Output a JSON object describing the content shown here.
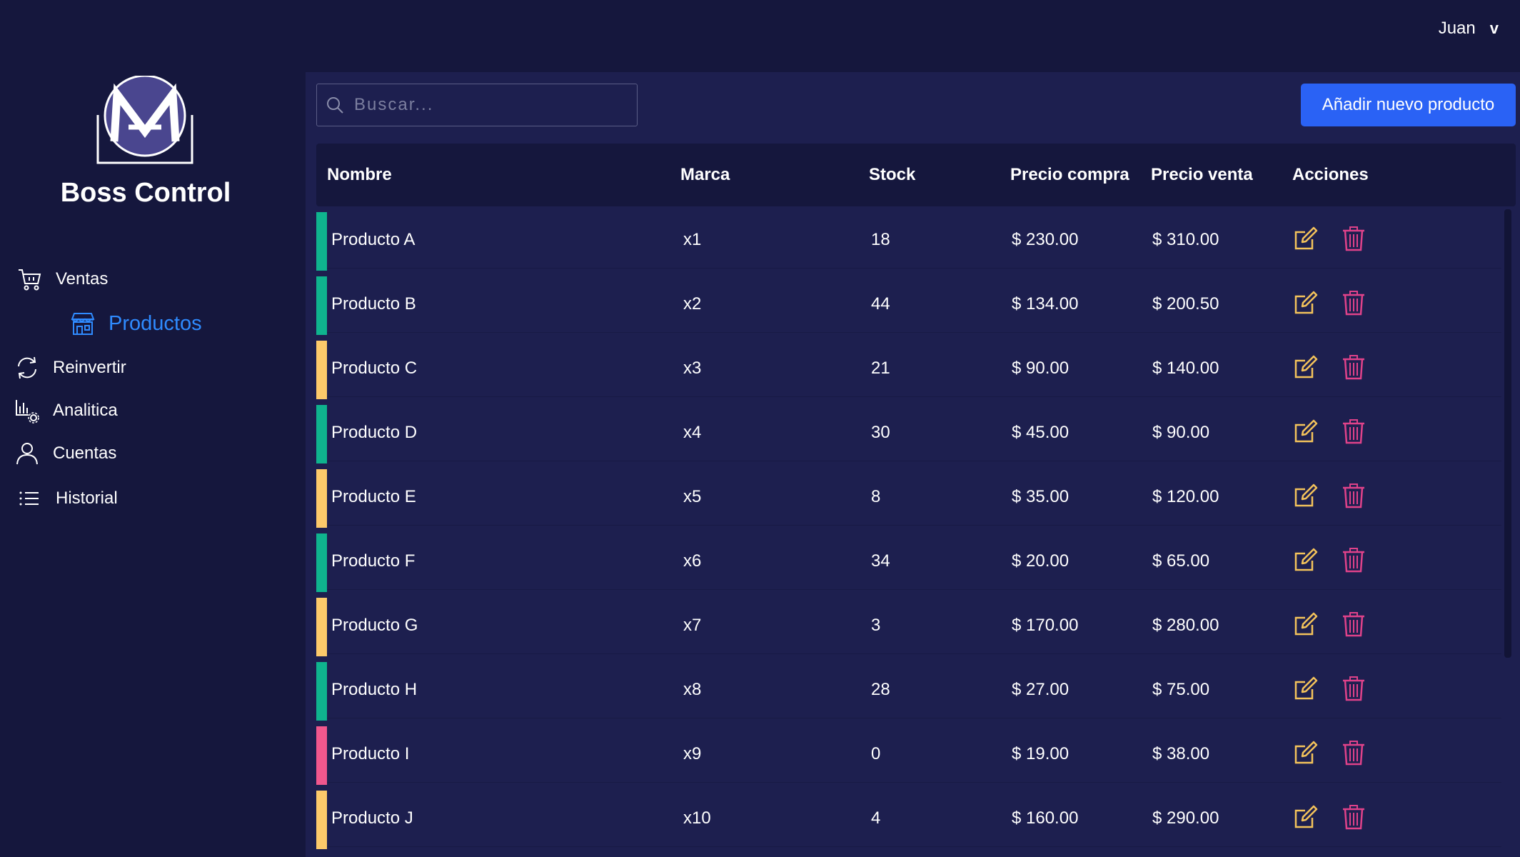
{
  "header": {
    "user_name": "Juan",
    "user_chevron": "v"
  },
  "sidebar": {
    "logo_icon": "boss-control-logo",
    "app_name": "Boss Control",
    "items": [
      {
        "label": "Ventas",
        "icon": "cart-icon"
      },
      {
        "label": "Productos",
        "icon": "store-icon",
        "active": true
      },
      {
        "label": "Reinvertir",
        "icon": "refresh-icon"
      },
      {
        "label": "Analitica",
        "icon": "chart-settings-icon"
      },
      {
        "label": "Cuentas",
        "icon": "user-icon"
      },
      {
        "label": "Historial",
        "icon": "list-icon"
      }
    ]
  },
  "toolbar": {
    "search_placeholder": "Buscar...",
    "add_button": "Añadir nuevo producto"
  },
  "table": {
    "headers": [
      "Nombre",
      "Marca",
      "Stock",
      "Precio compra",
      "Precio venta",
      "Acciones"
    ],
    "rows": [
      {
        "nombre": "Producto A",
        "marca": "x1",
        "stock": "18",
        "compra": "$ 230.00",
        "venta": "$ 310.00",
        "status_color": "#0fb38e"
      },
      {
        "nombre": "Producto B",
        "marca": "x2",
        "stock": "44",
        "compra": "$ 134.00",
        "venta": "$ 200.50",
        "status_color": "#0fb38e"
      },
      {
        "nombre": "Producto C",
        "marca": "x3",
        "stock": "21",
        "compra": "$ 90.00",
        "venta": "$ 140.00",
        "status_color": "#fcc96a"
      },
      {
        "nombre": "Producto D",
        "marca": "x4",
        "stock": "30",
        "compra": "$ 45.00",
        "venta": "$ 90.00",
        "status_color": "#0fb38e"
      },
      {
        "nombre": "Producto E",
        "marca": "x5",
        "stock": "8",
        "compra": "$ 35.00",
        "venta": "$ 120.00",
        "status_color": "#fcc96a"
      },
      {
        "nombre": "Producto F",
        "marca": "x6",
        "stock": "34",
        "compra": "$ 20.00",
        "venta": "$ 65.00",
        "status_color": "#0fb38e"
      },
      {
        "nombre": "Producto G",
        "marca": "x7",
        "stock": "3",
        "compra": "$ 170.00",
        "venta": "$ 280.00",
        "status_color": "#fcc96a"
      },
      {
        "nombre": "Producto H",
        "marca": "x8",
        "stock": "28",
        "compra": "$ 27.00",
        "venta": "$ 75.00",
        "status_color": "#0fb38e"
      },
      {
        "nombre": "Producto I",
        "marca": "x9",
        "stock": "0",
        "compra": "$ 19.00",
        "venta": "$ 38.00",
        "status_color": "#f0578d"
      },
      {
        "nombre": "Producto J",
        "marca": "x10",
        "stock": "4",
        "compra": "$ 160.00",
        "venta": "$ 290.00",
        "status_color": "#fcc96a"
      }
    ]
  },
  "colors": {
    "background": "#15173d",
    "panel": "#1d1f4f",
    "accent": "#2a62f5",
    "active_nav": "#2f8bff",
    "edit_icon": "#f4c35b",
    "delete_icon": "#e0428a"
  }
}
